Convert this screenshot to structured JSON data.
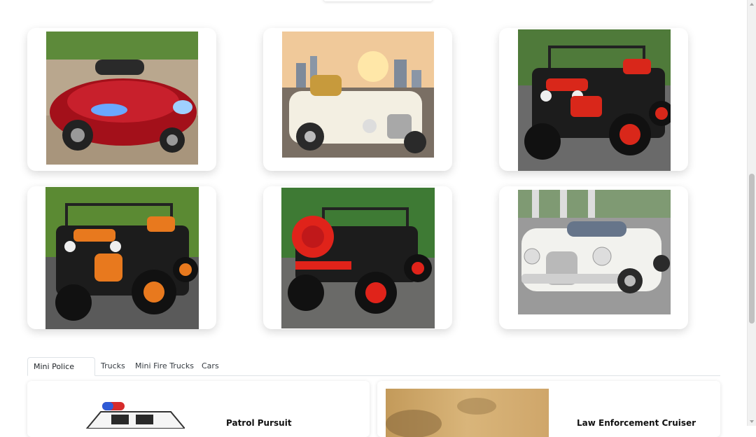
{
  "gallery": {
    "images": [
      {
        "alt": "red-sports-ride-on-car"
      },
      {
        "alt": "white-vintage-ride-on-car-city"
      },
      {
        "alt": "red-black-ride-on-jeep"
      },
      {
        "alt": "orange-black-ride-on-jeep"
      },
      {
        "alt": "red-black-ride-on-jeep-rear"
      },
      {
        "alt": "white-vintage-ride-on-car"
      }
    ]
  },
  "tabs": [
    {
      "label": "Mini Police Cars",
      "active": true
    },
    {
      "label": "Trucks",
      "active": false
    },
    {
      "label": "Mini Fire Trucks",
      "active": false
    },
    {
      "label": "Cars",
      "active": false
    }
  ],
  "products": [
    {
      "title": "Patrol Pursuit"
    },
    {
      "title": "Law Enforcement Cruiser"
    }
  ],
  "colors": {
    "card_bg": "#ffffff",
    "tab_border": "#dee2e6",
    "scroll_thumb": "#c1c1c1"
  }
}
